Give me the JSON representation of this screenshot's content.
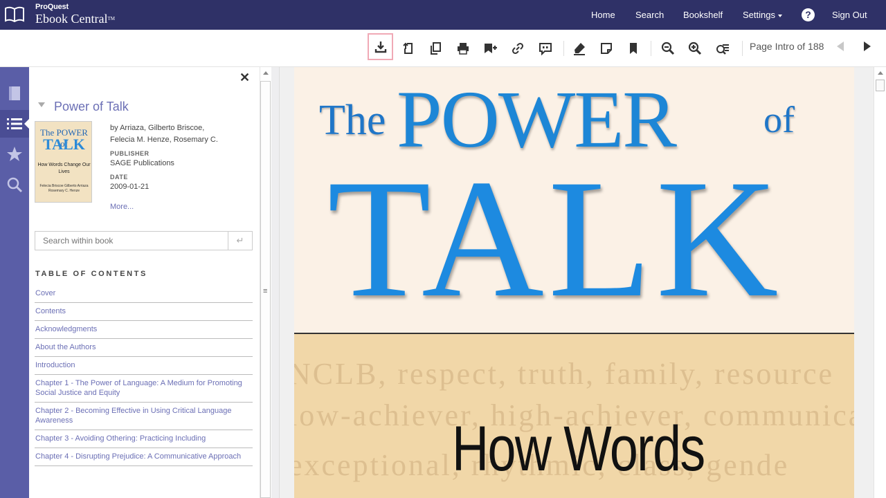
{
  "app": {
    "logo_sub": "ProQuest",
    "logo_main": "Ebook Central",
    "logo_tm": "TM"
  },
  "nav": {
    "home": "Home",
    "search": "Search",
    "bookshelf": "Bookshelf",
    "settings": "Settings",
    "help": "?",
    "signout": "Sign Out"
  },
  "toolbar": {
    "page_label": "Page Intro of 188",
    "icons": [
      "download-icon",
      "rotate-page-icon",
      "copy-icon",
      "print-icon",
      "add-to-shelf-icon",
      "link-icon",
      "citation-icon",
      "highlight-icon",
      "note-icon",
      "bookmark-icon",
      "zoom-out-icon",
      "zoom-in-icon",
      "fit-page-icon",
      "previous-page-icon",
      "next-page-icon"
    ]
  },
  "sidebar": {
    "close": "✕",
    "book_title": "Power of Talk",
    "authors_line1": "by Arriaza, Gilberto Briscoe,",
    "authors_line2": "Felecia M. Henze, Rosemary C.",
    "publisher_label": "PUBLISHER",
    "publisher": "SAGE Publications",
    "date_label": "DATE",
    "date": "2009-01-21",
    "more": "More...",
    "search_placeholder": "Search within book",
    "search_go": "↵",
    "toc_heading": "TABLE OF CONTENTS",
    "toc": [
      "Cover",
      "Contents",
      "Acknowledgments",
      "About the Authors",
      "Introduction",
      "Chapter 1 - The Power of Language: A Medium for Promoting Social Justice and Equity",
      "Chapter 2 - Becoming Effective in Using Critical Language Awareness",
      "Chapter 3 - Avoiding Othering: Practicing Including",
      "Chapter 4 - Disrupting Prejudice: A Communicative Approach"
    ]
  },
  "cover_thumb": {
    "title_top": "The POWER of",
    "title_main": "TALK",
    "subtitle": "How Words Change Our Lives",
    "authors": "Felecia Briscoe Gilberto Arriaza Rosemary C. Henze"
  },
  "page": {
    "the": "The",
    "power": "POWER",
    "of": "of",
    "talk": "TALK",
    "how_words": "How Words",
    "watermark_lines": [
      "NCLB, respect, truth, family, resource",
      "low-achiever, high-achiever, communicat",
      "exceptional, rhythmic, class, gende"
    ]
  },
  "colors": {
    "topbar": "#2f3167",
    "rail": "#5a5ea7",
    "link": "#6b6fb5",
    "title_blue": "#1d86d6"
  }
}
